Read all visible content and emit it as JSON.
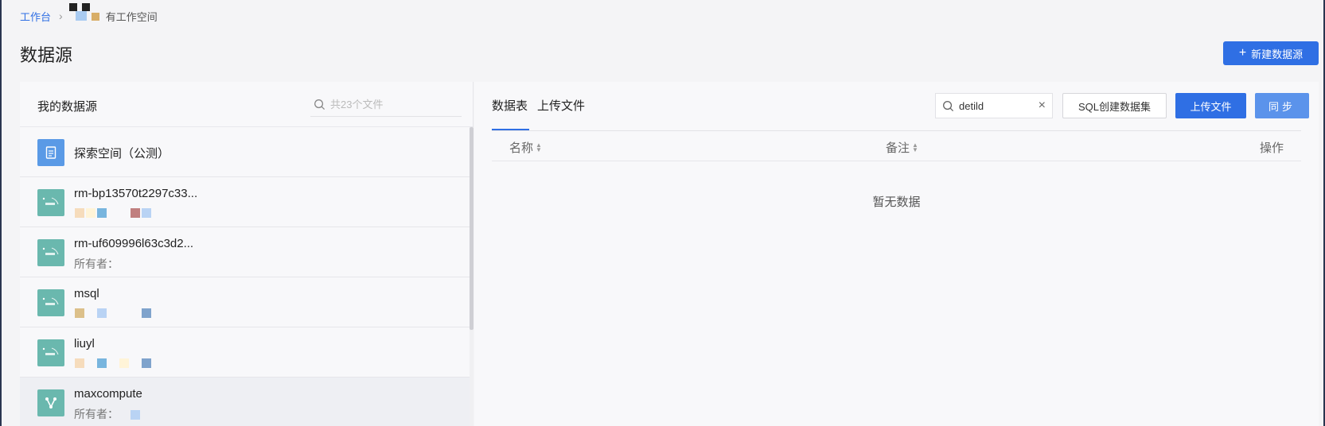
{
  "breadcrumb": {
    "home": "工作台",
    "separator": "›",
    "current": "有工作空间"
  },
  "page": {
    "title": "数据源",
    "new_button": "新建数据源",
    "new_button_icon": "+"
  },
  "left_panel": {
    "title": "我的数据源",
    "search_placeholder": "共23个文件",
    "items": [
      {
        "name": "探索空间（公测）",
        "owner": "",
        "icon": "document-icon"
      },
      {
        "name": "rm-bp13570t2297c33...",
        "owner": "",
        "icon": "mysql-icon"
      },
      {
        "name": "rm-uf609996l63c3d2...",
        "owner": "所有者：",
        "icon": "mysql-icon"
      },
      {
        "name": "msql",
        "owner": "",
        "icon": "mysql-icon"
      },
      {
        "name": "liuyl",
        "owner": "",
        "icon": "mysql-icon"
      },
      {
        "name": "maxcompute",
        "owner": "所有者：",
        "icon": "maxcompute-icon"
      }
    ]
  },
  "right_panel": {
    "tabs": [
      "数据表",
      "上传文件"
    ],
    "search_value": "detild",
    "clear_icon": "×",
    "sql_button": "SQL创建数据集",
    "upload_button": "上传文件",
    "sync_button": "同步",
    "columns": [
      "名称",
      "备注",
      "操作"
    ],
    "empty_text": "暂无数据"
  },
  "colors": {
    "primary": "#2f6fe4",
    "sync": "#5b93eb",
    "teal_icon": "#6ab8ae",
    "blue_icon": "#5a9ae6"
  }
}
